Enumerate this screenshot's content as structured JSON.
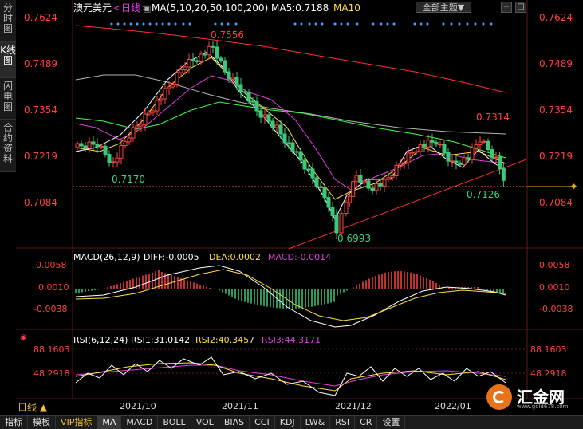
{
  "side_tabs": [
    {
      "label": "分时图",
      "active": false
    },
    {
      "label": "K线图",
      "active": true
    },
    {
      "label": "闪电图",
      "active": false
    },
    {
      "label": "合约资料",
      "active": false
    }
  ],
  "header": {
    "symbol": "澳元美元",
    "period": "<日线>",
    "ma_label": "MA(5,10,20,50,100,200)",
    "ma5": "MA5:0.7188",
    "ma10": "MA10",
    "theme_button": "全部主题▼",
    "btn_minus": "−",
    "btn_restore": "□"
  },
  "price_axis": {
    "left_ticks": [
      "0.7624",
      "0.7489",
      "0.7354",
      "0.7219",
      "0.7084"
    ],
    "right_ticks": [
      "0.7624",
      "0.7489",
      "0.7354",
      "0.7219",
      "0.7084"
    ]
  },
  "annotations": {
    "high1": "0.7556",
    "low1": "0.7170",
    "low2": "0.6993",
    "high2": "0.7314",
    "low3": "0.7126"
  },
  "macd": {
    "label": "MACD(26,12,9)",
    "diff": "DIFF:-0.0005",
    "dea": "DEA:0.0002",
    "macd": "MACD:-0.0014",
    "ticks": [
      "0.0058",
      "0.0010",
      "-0.0038"
    ]
  },
  "rsi": {
    "label": "RSI(6,12,24)",
    "rsi1": "RSI1:31.0142",
    "rsi2": "RSI2:40.3457",
    "rsi3": "RSI3:44.3171",
    "ticks": [
      "88.1603",
      "48.2918"
    ]
  },
  "date_axis": [
    "2021/10",
    "2021/11",
    "2021/12",
    "2022/01"
  ],
  "period_tab": "日线 ▲",
  "toolbar": [
    "指标",
    "模板",
    "VIP指标",
    "MA",
    "MACD",
    "BOLL",
    "VOL",
    "BIAS",
    "CCI",
    "KDJ",
    "LW&",
    "RSI",
    "CR",
    "设置"
  ],
  "toolbar_selected": "MA",
  "logo": {
    "name": "汇金网",
    "url": "www.gold678.com"
  },
  "colors": {
    "up": "#ff4040",
    "down": "#3cc878",
    "ma5": "#ffffff",
    "ma10": "#ffe040",
    "ma20": "#e040e0",
    "ma50": "#40ff40",
    "ma100": "#b4b4b4",
    "ma200": "#ff3030",
    "axis_text": "#ff4040",
    "grid": "#3a1010"
  }
}
